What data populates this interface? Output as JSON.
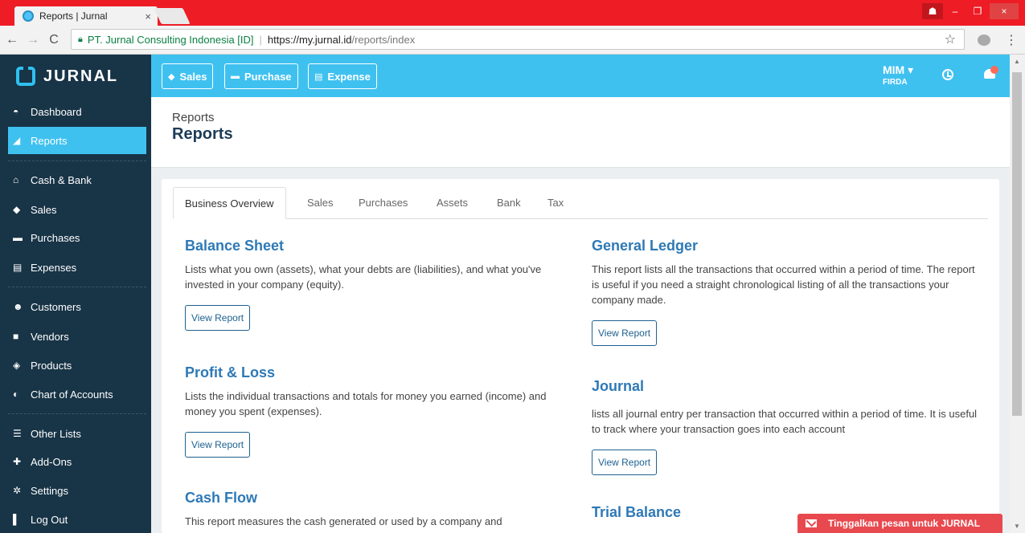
{
  "browser": {
    "tab_title": "Reports | Jurnal",
    "tab_close": "×",
    "back": "←",
    "forward": "→",
    "reload": "C",
    "org": "PT. Jurnal Consulting Indonesia [ID]",
    "url_host": "https://my.jurnal.id",
    "url_path": "/reports/index",
    "star": "☆",
    "menu": "⋮",
    "win_minimize": "–",
    "win_restore": "❐",
    "win_close": "×"
  },
  "sidebar": {
    "logo": "JURNAL",
    "items": [
      {
        "label": "Dashboard",
        "icon": "dashboard-icon",
        "glyph": "◓"
      },
      {
        "label": "Reports",
        "icon": "chart-icon",
        "glyph": "◢"
      },
      {
        "label": "Cash & Bank",
        "icon": "bank-icon",
        "glyph": "⌂"
      },
      {
        "label": "Sales",
        "icon": "tag-icon",
        "glyph": "◆"
      },
      {
        "label": "Purchases",
        "icon": "card-icon",
        "glyph": "▬"
      },
      {
        "label": "Expenses",
        "icon": "receipt-icon",
        "glyph": "▤"
      },
      {
        "label": "Customers",
        "icon": "users-icon",
        "glyph": "☻"
      },
      {
        "label": "Vendors",
        "icon": "truck-icon",
        "glyph": "■"
      },
      {
        "label": "Products",
        "icon": "box-icon",
        "glyph": "◈"
      },
      {
        "label": "Chart of Accounts",
        "icon": "book-icon",
        "glyph": "◐"
      },
      {
        "label": "Other Lists",
        "icon": "list-icon",
        "glyph": "☰"
      },
      {
        "label": "Add-Ons",
        "icon": "puzzle-icon",
        "glyph": "✚"
      },
      {
        "label": "Settings",
        "icon": "gear-icon",
        "glyph": "✲"
      },
      {
        "label": "Log Out",
        "icon": "logout-icon",
        "glyph": "▌"
      }
    ]
  },
  "topbar": {
    "quick": [
      {
        "label": "Sales",
        "glyph": "◆"
      },
      {
        "label": "Purchase",
        "glyph": "▬"
      },
      {
        "label": "Expense",
        "glyph": "▤"
      }
    ],
    "user_name": "MIM ▾",
    "user_sub": "FIRDA"
  },
  "page": {
    "breadcrumb": "Reports",
    "title": "Reports"
  },
  "tabs": [
    "Business Overview",
    "Sales",
    "Purchases",
    "Assets",
    "Bank",
    "Tax"
  ],
  "reports": [
    {
      "title": "Balance Sheet",
      "desc": "Lists what you own (assets), what your debts are (liabilities), and what you've invested in your company (equity).",
      "button": "View Report"
    },
    {
      "title": "General Ledger",
      "desc": "This report lists all the transactions that occurred within a period of time. The report is useful if you need a straight chronological listing of all the transactions your company made.",
      "button": "View Report"
    },
    {
      "title": "Profit & Loss",
      "desc": "Lists the individual transactions and totals for money you earned (income) and money you spent (expenses).",
      "button": "View Report"
    },
    {
      "title": "Journal",
      "desc": "lists all journal entry per transaction that occurred within a period of time. It is useful to track where your transaction goes into each account",
      "button": "View Report"
    },
    {
      "title": "Cash Flow",
      "desc": "This report measures the cash generated or used by a company and",
      "button": ""
    },
    {
      "title": "Trial Balance",
      "desc": "",
      "button": ""
    }
  ],
  "chat": {
    "label": "Tinggalkan pesan untuk JURNAL"
  },
  "colors": {
    "accent": "#3fc1f0",
    "sidebar": "#183447",
    "browser": "#ee1c25",
    "link": "#2e79b6",
    "chat": "#e8494f"
  }
}
